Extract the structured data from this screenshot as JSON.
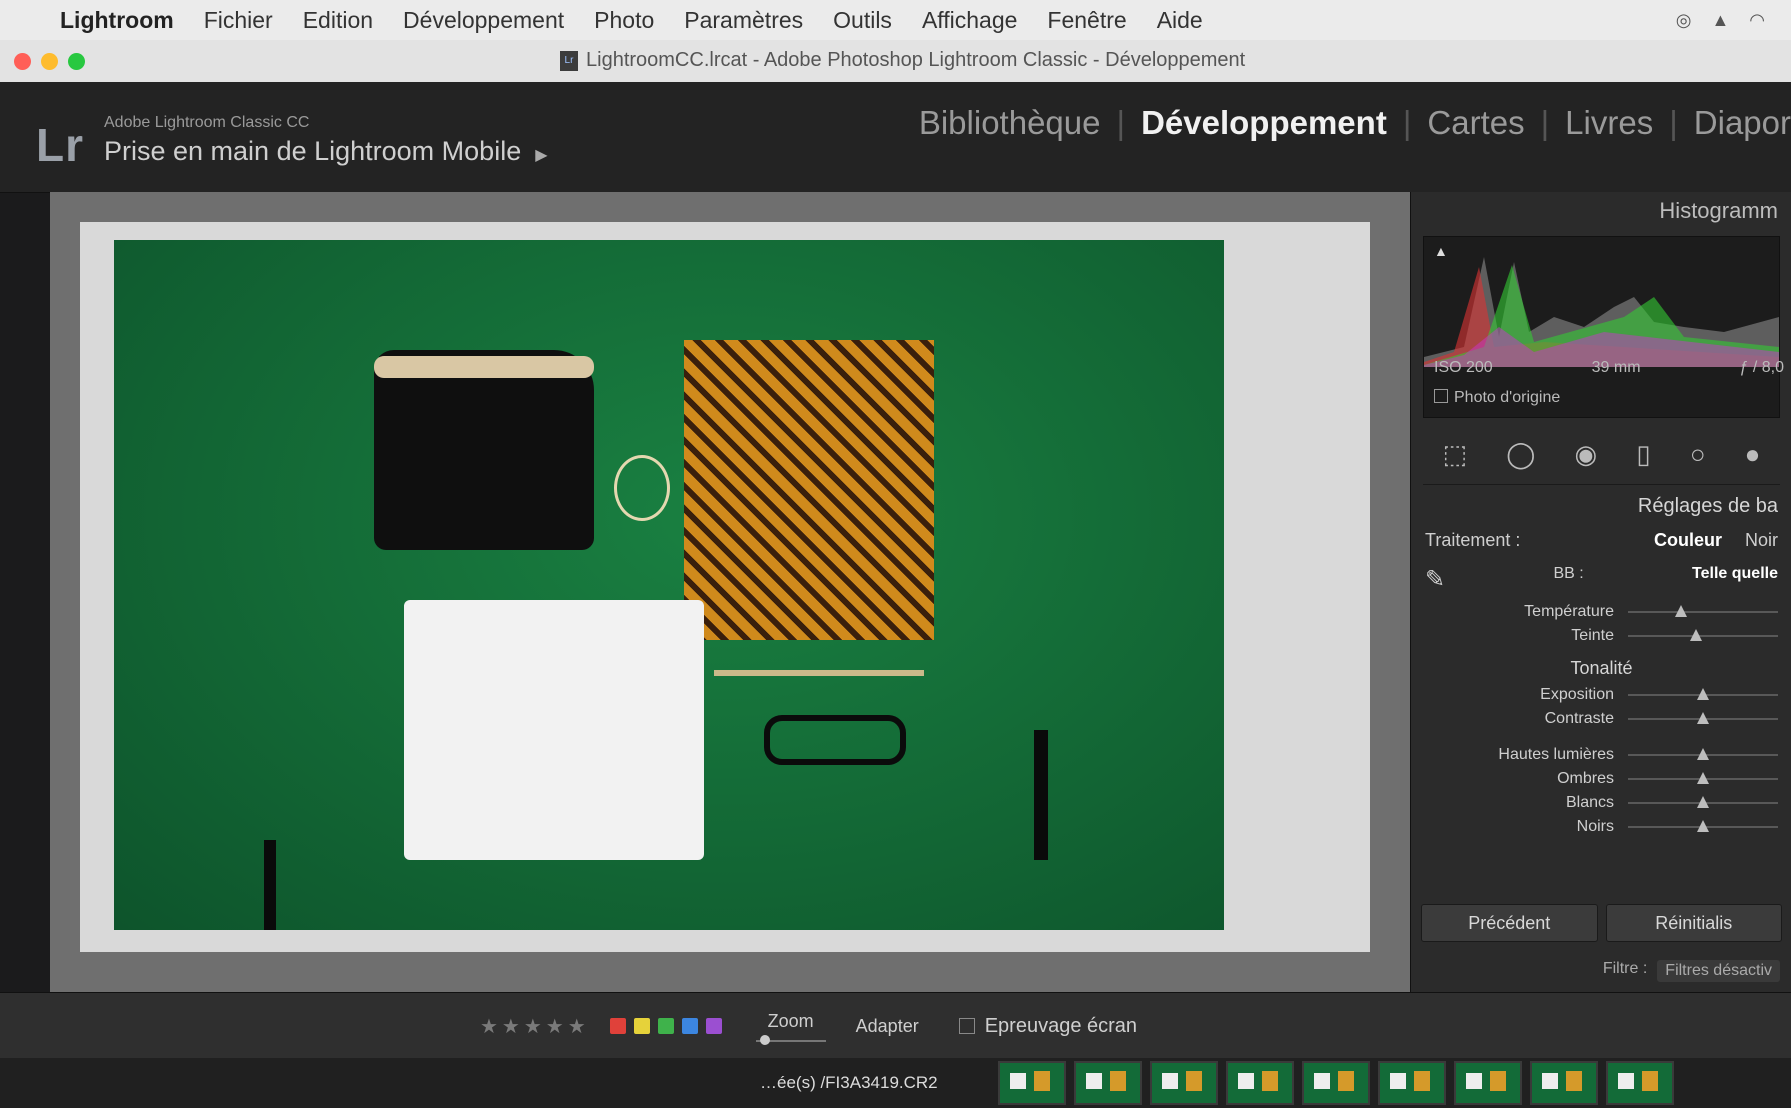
{
  "menubar": {
    "app_name": "Lightroom",
    "items": [
      "Fichier",
      "Edition",
      "Développement",
      "Photo",
      "Paramètres",
      "Outils",
      "Affichage",
      "Fenêtre",
      "Aide"
    ]
  },
  "window": {
    "title": "LightroomCC.lrcat - Adobe Photoshop Lightroom Classic - Développement"
  },
  "identity": {
    "logo": "Lr",
    "product": "Adobe Lightroom Classic CC",
    "catalog_title": "Prise en main de Lightroom Mobile"
  },
  "modules": {
    "items": [
      "Bibliothèque",
      "Développement",
      "Cartes",
      "Livres",
      "Diapor"
    ],
    "active": "Développement"
  },
  "right_panel": {
    "histogram_label": "Histogramm",
    "exif": {
      "iso": "ISO 200",
      "focal": "39 mm",
      "aperture": "ƒ / 8,0"
    },
    "original_photo": "Photo d'origine",
    "basic_title": "Réglages de ba",
    "treatment_label": "Traitement :",
    "treatment_options": [
      "Couleur",
      "Noir"
    ],
    "wb_label": "BB :",
    "wb_mode": "Telle quelle",
    "wb_sliders": [
      {
        "label": "Température",
        "pos": 0.35
      },
      {
        "label": "Teinte",
        "pos": 0.45
      }
    ],
    "tone_title": "Tonalité",
    "tone_sliders": [
      {
        "label": "Exposition",
        "pos": 0.5
      },
      {
        "label": "Contraste",
        "pos": 0.5
      }
    ],
    "presence_sliders": [
      {
        "label": "Hautes lumières",
        "pos": 0.5
      },
      {
        "label": "Ombres",
        "pos": 0.5
      },
      {
        "label": "Blancs",
        "pos": 0.5
      },
      {
        "label": "Noirs",
        "pos": 0.5
      }
    ],
    "prev_button": "Précédent",
    "reset_button": "Réinitialis",
    "filter_label": "Filtre :",
    "filter_value": "Filtres désactiv"
  },
  "toolbar": {
    "stars": "★★★★★",
    "colors": [
      "#e0413a",
      "#e6d23a",
      "#3fb24b",
      "#3c86e0",
      "#9b4fd1"
    ],
    "zoom_label": "Zoom",
    "adapter_label": "Adapter",
    "proof_label": "Epreuvage écran"
  },
  "filmstrip": {
    "filename": "…ée(s) /FI3A3419.CR2",
    "thumb_count": 9
  }
}
